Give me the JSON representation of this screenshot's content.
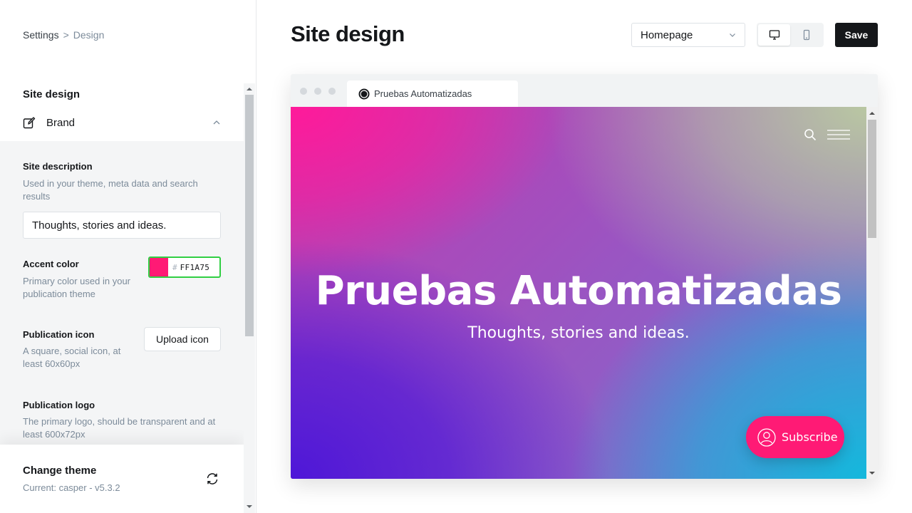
{
  "breadcrumb": {
    "root": "Settings",
    "separator": ">",
    "current": "Design"
  },
  "sidebar": {
    "section_title": "Site design",
    "group": {
      "label": "Brand",
      "icon": "edit-icon",
      "state_icon": "chevron-up-icon"
    },
    "fields": {
      "site_description": {
        "label": "Site description",
        "hint": "Used in your theme, meta data and search results",
        "value": "Thoughts, stories and ideas."
      },
      "accent_color": {
        "label": "Accent color",
        "hint": "Primary color used in your publication theme",
        "hash": "#",
        "value": "FF1A75",
        "swatch": "#ff1a75"
      },
      "publication_icon": {
        "label": "Publication icon",
        "hint": "A square, social icon, at least 60x60px",
        "button": "Upload icon"
      },
      "publication_logo": {
        "label": "Publication logo",
        "hint": "The primary logo, should be transparent and at least 600x72px"
      }
    },
    "theme": {
      "title": "Change theme",
      "current": "Current: casper - v5.3.2",
      "icon": "refresh-icon"
    }
  },
  "header": {
    "title": "Site design",
    "page_select": "Homepage",
    "device_toggle": [
      "desktop-icon",
      "mobile-icon"
    ],
    "active_device": "desktop",
    "save": "Save"
  },
  "preview": {
    "tab_title": "Pruebas Automatizadas",
    "site_title": "Pruebas Automatizadas",
    "site_description": "Thoughts, stories and ideas.",
    "subscribe": "Subscribe",
    "accent": "#ff1a75"
  }
}
